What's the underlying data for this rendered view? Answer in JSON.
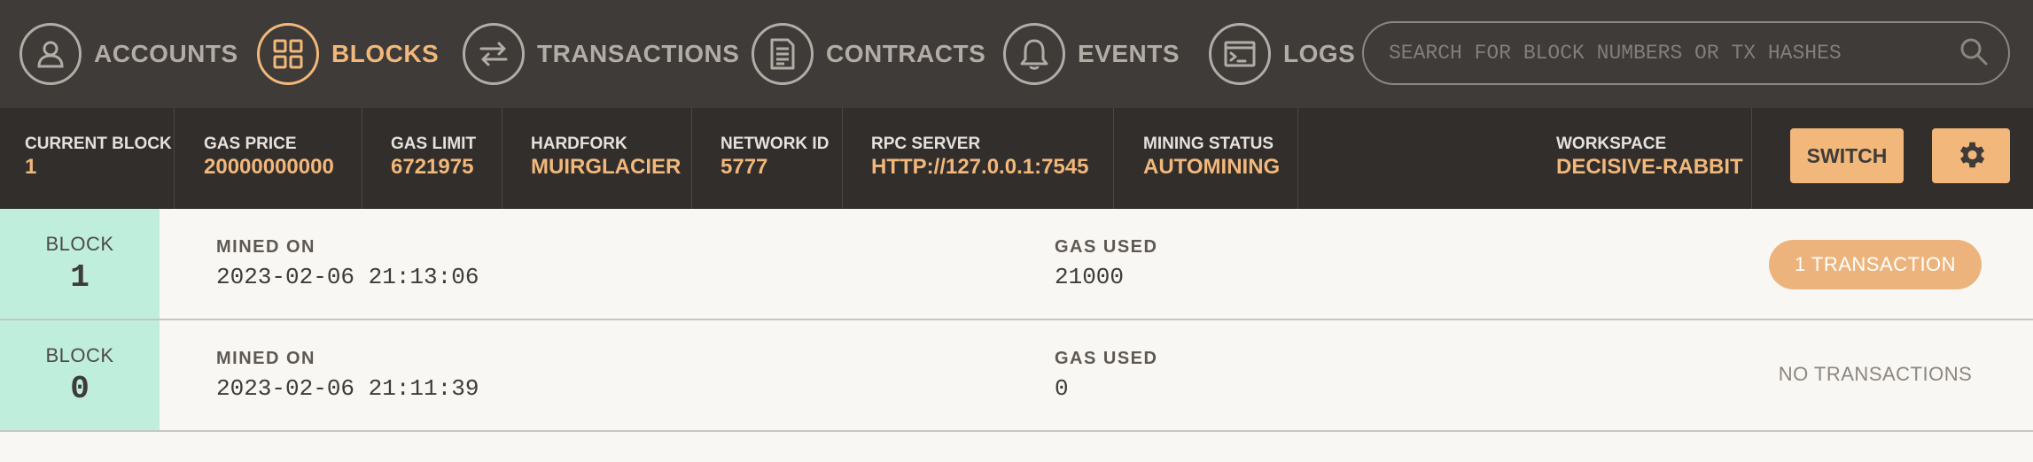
{
  "nav": {
    "items": [
      {
        "label": "ACCOUNTS",
        "icon": "user-icon",
        "active": false
      },
      {
        "label": "BLOCKS",
        "icon": "grid-icon",
        "active": true
      },
      {
        "label": "TRANSACTIONS",
        "icon": "swap-arrows-icon",
        "active": false
      },
      {
        "label": "CONTRACTS",
        "icon": "document-icon",
        "active": false
      },
      {
        "label": "EVENTS",
        "icon": "bell-icon",
        "active": false
      },
      {
        "label": "LOGS",
        "icon": "terminal-icon",
        "active": false
      }
    ],
    "search_placeholder": "SEARCH FOR BLOCK NUMBERS OR TX HASHES"
  },
  "stats": {
    "current_block": {
      "label": "CURRENT BLOCK",
      "value": "1"
    },
    "gas_price": {
      "label": "GAS PRICE",
      "value": "20000000000"
    },
    "gas_limit": {
      "label": "GAS LIMIT",
      "value": "6721975"
    },
    "hardfork": {
      "label": "HARDFORK",
      "value": "MUIRGLACIER"
    },
    "network_id": {
      "label": "NETWORK ID",
      "value": "5777"
    },
    "rpc_server": {
      "label": "RPC SERVER",
      "value": "HTTP://127.0.0.1:7545"
    },
    "mining_status": {
      "label": "MINING STATUS",
      "value": "AUTOMINING"
    },
    "workspace": {
      "label": "WORKSPACE",
      "value": "DECISIVE-RABBIT"
    }
  },
  "buttons": {
    "switch": "SWITCH",
    "settings_icon": "gear-icon"
  },
  "blocks": [
    {
      "block_label": "BLOCK",
      "number": "1",
      "mined_label": "MINED ON",
      "mined_on": "2023-02-06 21:13:06",
      "gas_label": "GAS USED",
      "gas_used": "21000",
      "tx": "1 TRANSACTION"
    },
    {
      "block_label": "BLOCK",
      "number": "0",
      "mined_label": "MINED ON",
      "mined_on": "2023-02-06 21:11:39",
      "gas_label": "GAS USED",
      "gas_used": "0",
      "tx": "NO TRANSACTIONS"
    }
  ],
  "colors": {
    "accent": "#f2b77a",
    "nav_bg": "#3e3b39",
    "statbar_bg": "#312e2c",
    "block_cell": "#bfeedd"
  }
}
